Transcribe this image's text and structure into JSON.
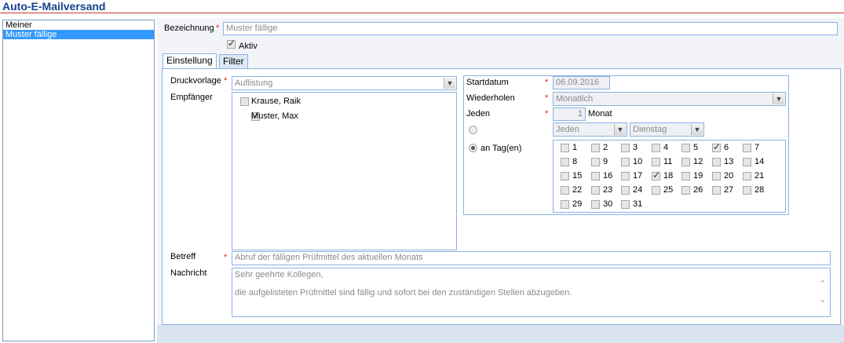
{
  "window": {
    "title": "Auto-E-Mailversand"
  },
  "list": {
    "items": [
      {
        "label": "Meiner",
        "selected": false
      },
      {
        "label": "Muster fällige",
        "selected": true
      }
    ]
  },
  "form": {
    "bezeichnung_label": "Bezeichnung",
    "bezeichnung_value": "Muster fällige",
    "aktiv_label": "Aktiv",
    "aktiv_checked": true,
    "required_marker": "*"
  },
  "tabs": [
    {
      "label": "Einstellung",
      "active": true
    },
    {
      "label": "Filter",
      "active": false
    }
  ],
  "einstellung": {
    "druckvorlage_label": "Druckvorlage",
    "druckvorlage_value": "Auflistung",
    "empfaenger_label": "Empfänger",
    "recipients": [
      {
        "name": "Krause, Raik",
        "checked": false
      },
      {
        "name": "Muster, Max",
        "checked": true
      }
    ],
    "betreff_label": "Betreff",
    "betreff_value": "Abruf der fälligen Prüfmittel des aktuellen Monats",
    "nachricht_label": "Nachricht",
    "nachricht_line1": "Sehr geehrte Kollegen,",
    "nachricht_line2": "die aufgelisteten Prüfmittel sind fällig und sofort bei den zuständigen Stellen abzugeben."
  },
  "schedule": {
    "startdatum_label": "Startdatum",
    "startdatum_value": "06.09.2016",
    "wiederholen_label": "Wiederholen",
    "wiederholen_value": "Monatlich",
    "jeden_label": "Jeden",
    "jeden_value": "1",
    "jeden_unit": "Monat",
    "weekday_ordinal_value": "Jeden",
    "weekday_value": "Dienstag",
    "an_tag_label": "an Tag(en)",
    "selected_option": "an Tag(en)",
    "days": [
      "1",
      "2",
      "3",
      "4",
      "5",
      "6",
      "7",
      "8",
      "9",
      "10",
      "11",
      "12",
      "13",
      "14",
      "15",
      "16",
      "17",
      "18",
      "19",
      "20",
      "21",
      "22",
      "23",
      "24",
      "25",
      "26",
      "27",
      "28",
      "29",
      "30",
      "31"
    ],
    "checked_days": [
      "6",
      "18"
    ]
  },
  "colors": {
    "title": "#15428b",
    "title_rule": "#c8372b",
    "selection": "#3399ff",
    "border": "#8db2e3"
  }
}
